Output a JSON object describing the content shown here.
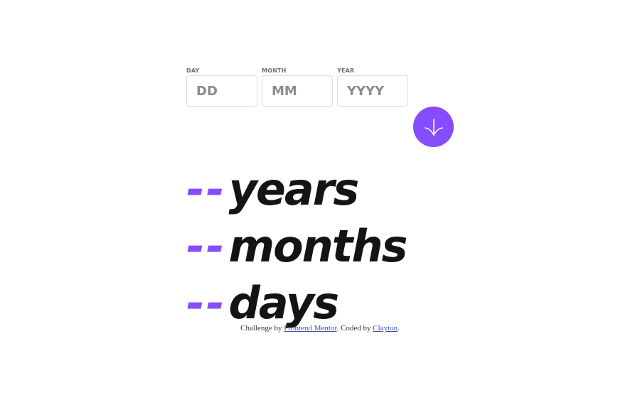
{
  "form": {
    "day": {
      "label": "DAY",
      "placeholder": "DD",
      "value": ""
    },
    "month": {
      "label": "MONTH",
      "placeholder": "MM",
      "value": ""
    },
    "year": {
      "label": "YEAR",
      "placeholder": "YYYY",
      "value": ""
    },
    "submit_icon": "arrow-down-icon"
  },
  "results": {
    "years": {
      "value": "--",
      "unit": "years"
    },
    "months": {
      "value": "--",
      "unit": "months"
    },
    "days": {
      "value": "--",
      "unit": "days"
    }
  },
  "attribution": {
    "prefix": "Challenge by ",
    "challenge_link": "Frontend Mentor",
    "middle": ". Coded by ",
    "author_link": "Clayton",
    "suffix": "."
  },
  "colors": {
    "accent": "#854dff",
    "text": "#141414",
    "label": "#716f6f",
    "border": "#dcdcdc"
  }
}
